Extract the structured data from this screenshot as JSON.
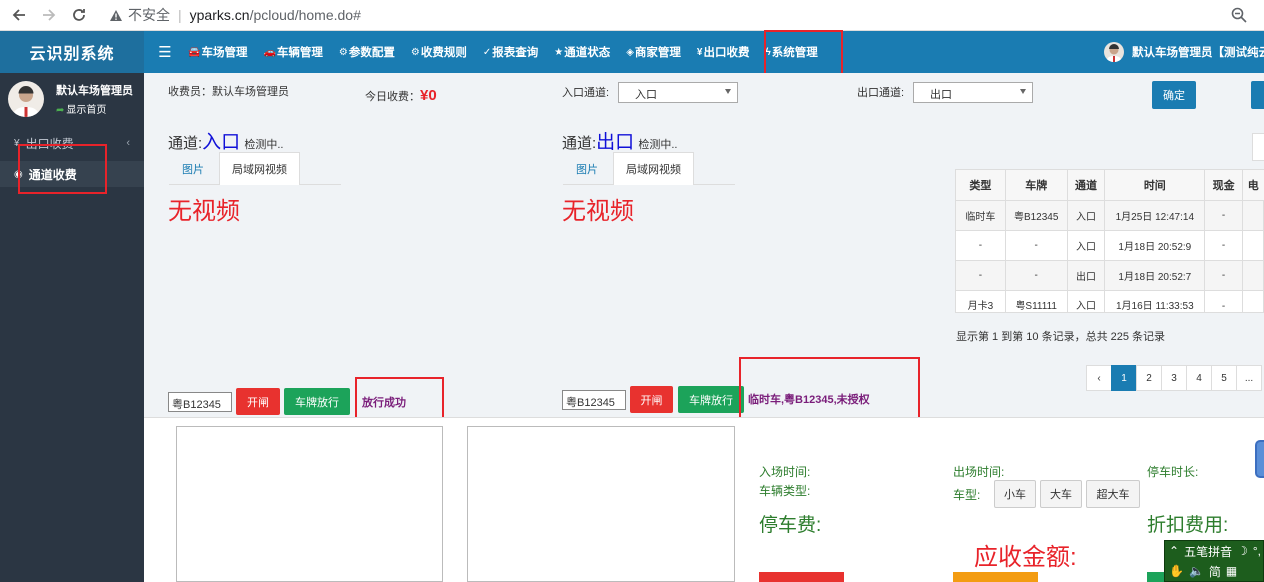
{
  "browser": {
    "insecure_label": "不安全",
    "url_host": "yparks.cn",
    "url_path": "/pcloud/home.do#"
  },
  "app": {
    "title": "云识别系统",
    "nav": [
      {
        "label": "车场管理",
        "icon": "car-icon"
      },
      {
        "label": "车辆管理",
        "icon": "car-icon"
      },
      {
        "label": "参数配置",
        "icon": "gear-icon"
      },
      {
        "label": "收费规则",
        "icon": "gears-icon"
      },
      {
        "label": "报表查询",
        "icon": "chart-icon"
      },
      {
        "label": "通道状态",
        "icon": "star-icon"
      },
      {
        "label": "商家管理",
        "icon": "tag-icon"
      },
      {
        "label": "出口收费",
        "icon": "yen-icon"
      },
      {
        "label": "系统管理",
        "icon": "wrench-icon"
      }
    ],
    "user_top": "默认车场管理员【测试纯云"
  },
  "sidebar": {
    "user_name": "默认车场管理员",
    "home_link": "显示首页",
    "items": [
      {
        "label": "出口收费",
        "icon": "yen-icon",
        "active": false
      },
      {
        "label": "通道收费",
        "icon": "circle-icon",
        "active": true
      }
    ]
  },
  "toolbar": {
    "cashier_label": "收费员：",
    "cashier_name": "默认车场管理员",
    "today_label": "今日收费：",
    "today_value": "¥0",
    "entry_label": "入口通道:",
    "entry_value": "入口",
    "exit_label": "出口通道:",
    "exit_value": "出口",
    "confirm": "确定"
  },
  "channels": [
    {
      "prefix": "通道:",
      "name": "入口",
      "status": "检测中..",
      "tab_picture": "图片",
      "tab_lan_video": "局域网视频",
      "no_video": "无视频",
      "plate": "粤B12345",
      "open_gate": "开闸",
      "plate_release": "车牌放行",
      "message": "放行成功"
    },
    {
      "prefix": "通道:",
      "name": "出口",
      "status": "检测中..",
      "tab_picture": "图片",
      "tab_lan_video": "局域网视频",
      "no_video": "无视频",
      "plate": "粤B12345",
      "open_gate": "开闸",
      "plate_release": "车牌放行",
      "message": "临时车,粤B12345,未授权"
    }
  ],
  "records": {
    "headers": [
      "类型",
      "车牌",
      "通道",
      "时间",
      "现金",
      "电"
    ],
    "rows": [
      [
        "临时车",
        "粤B12345",
        "入口",
        "1月25日 12:47:14",
        "-",
        ""
      ],
      [
        "-",
        "-",
        "入口",
        "1月18日 20:52:9",
        "-",
        ""
      ],
      [
        "-",
        "-",
        "出口",
        "1月18日 20:52:7",
        "-",
        ""
      ],
      [
        "月卡3",
        "粤S11111",
        "入口",
        "1月16日 11:33:53",
        "-",
        ""
      ]
    ],
    "page_info": "显示第 1 到第 10 条记录，总共 225 条记录",
    "pages": [
      "‹",
      "1",
      "2",
      "3",
      "4",
      "5",
      "..."
    ],
    "active_page": "1"
  },
  "fees": {
    "entry_time_label": "入场时间:",
    "vehicle_type_label": "车辆类型:",
    "exit_time_label": "出场时间:",
    "car_model_label": "车型:",
    "duration_label": "停车时长:",
    "parking_fee_label": "停车费:",
    "discount_fee_label": "折扣费用:",
    "amount_due_label": "应收金额:",
    "sizes": [
      "小车",
      "大车",
      "超大车"
    ]
  },
  "ime": {
    "row1": "五笔拼音",
    "row2": "简"
  },
  "colors": {
    "header": "#1a7cb2",
    "sidebar": "#2b3643",
    "highlight": "#e8232a",
    "channel_name": "#1010d8"
  }
}
